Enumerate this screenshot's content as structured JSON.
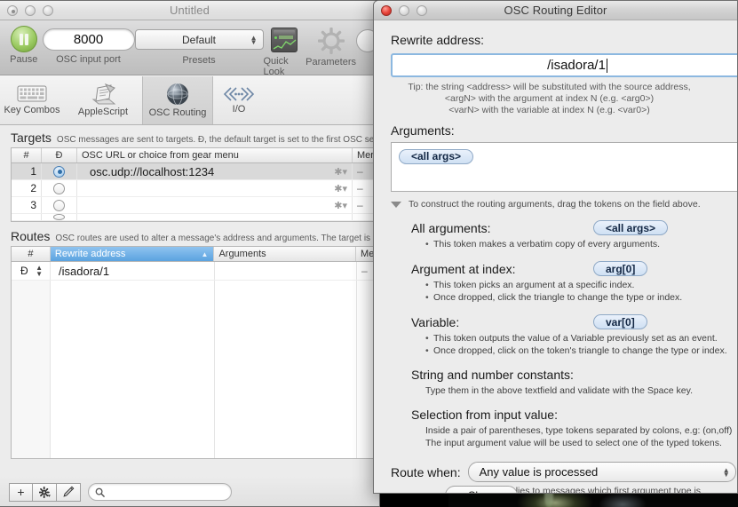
{
  "main_window": {
    "title": "Untitled",
    "toolbar": {
      "pause_label": "Pause",
      "port_label": "OSC input port",
      "port_value": "8000",
      "presets_label": "Presets",
      "presets_value": "Default",
      "quick_look_label": "Quick Look",
      "parameters_label": "Parameters"
    },
    "tabs": [
      {
        "label": "Key Combos",
        "icon": "keyboard-icon",
        "selected": false
      },
      {
        "label": "AppleScript",
        "icon": "applescript-script-icon",
        "selected": false
      },
      {
        "label": "OSC Routing",
        "icon": "globe-icon",
        "selected": true
      },
      {
        "label": "I/O",
        "icon": "io-arrows-icon",
        "selected": false
      }
    ],
    "targets": {
      "title": "Targets",
      "description": "OSC messages are sent to targets.  Ð, the default target is set to the first OSC ser",
      "columns": [
        "#",
        "Ð",
        "OSC URL or choice from gear menu",
        "Mer"
      ],
      "rows": [
        {
          "num": "1",
          "default": true,
          "url": "osc.udp://localhost:1234",
          "mem": "–",
          "selected": true
        },
        {
          "num": "2",
          "default": false,
          "url": "",
          "mem": "–",
          "selected": false
        },
        {
          "num": "3",
          "default": false,
          "url": "",
          "mem": "–",
          "selected": false
        }
      ]
    },
    "routes": {
      "title": "Routes",
      "description": "OSC routes are used to alter a message's address and arguments.  The target is d",
      "columns": [
        "#",
        "Rewrite address",
        "Arguments",
        "Mer"
      ],
      "sorted_column": "Rewrite address",
      "rows": [
        {
          "num": "Ð",
          "rewrite_address": "/isadora/1",
          "arguments": "",
          "mem": "–"
        }
      ]
    },
    "bottom_bar": {
      "add_label": "+",
      "gear_label": "gear-icon",
      "edit_label": "pencil-icon",
      "search_placeholder": "",
      "search_value": ""
    }
  },
  "osc_dialog": {
    "title": "OSC Routing Editor",
    "rewrite_address_label": "Rewrite address:",
    "rewrite_address_value": "/isadora/1",
    "tip_lines": [
      "Tip: the string <address> will be substituted with the source address,",
      "<argN> with the argument at index N (e.g. <arg0>)",
      "<varN> with the variable at index N (e.g. <var0>)"
    ],
    "arguments_label": "Arguments:",
    "arguments_tokens": [
      "<all args>"
    ],
    "disclosure_hint": "To construct the routing arguments, drag the tokens on the field above.",
    "help_sections": [
      {
        "title": "All arguments:",
        "token": "<all args>",
        "bullets": [
          "This token makes a verbatim copy of every arguments."
        ]
      },
      {
        "title": "Argument at index:",
        "token": "arg[0]",
        "bullets": [
          "This token picks an argument at a specific index.",
          "Once dropped, click the triangle to change the type or index."
        ]
      },
      {
        "title": "Variable:",
        "token": "var[0]",
        "bullets": [
          "This token outputs the value of a Variable previously set as an event.",
          "Once dropped, click on the token's triangle to change the type or index."
        ]
      }
    ],
    "constants_title": "String and number constants:",
    "constants_note": "Type them in the above textfield and validate with the Space key.",
    "selection_title": "Selection from input value:",
    "selection_notes": [
      "Inside a pair of parentheses, type tokens separated by colons, e.g: (on,off)",
      "The input argument value will be used to select one of the typed tokens."
    ],
    "route_when_label": "Route when:",
    "route_when_value": "Any value is processed",
    "route_when_note": "only applies to messages which first argument type is numerical",
    "close_button_label": "Close"
  },
  "colors": {
    "accent_blue": "#5ba3e0",
    "token_blue": "#cfe0f3",
    "window_bg": "#ececec",
    "pause_green": "#9ccb63",
    "close_red": "#e8443a"
  }
}
